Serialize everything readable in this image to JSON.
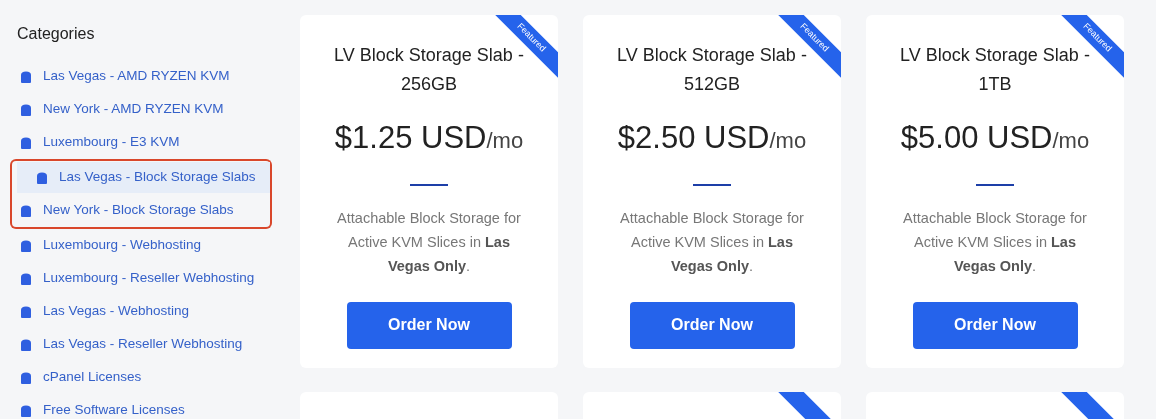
{
  "sidebar": {
    "title": "Categories",
    "items": [
      {
        "label": "Las Vegas - AMD RYZEN KVM",
        "selected": false,
        "highlighted": false
      },
      {
        "label": "New York - AMD RYZEN KVM",
        "selected": false,
        "highlighted": false
      },
      {
        "label": "Luxembourg - E3 KVM",
        "selected": false,
        "highlighted": false
      },
      {
        "label": "Las Vegas - Block Storage Slabs",
        "selected": true,
        "highlighted": true
      },
      {
        "label": "New York - Block Storage Slabs",
        "selected": false,
        "highlighted": true
      },
      {
        "label": "Luxembourg - Webhosting",
        "selected": false,
        "highlighted": false
      },
      {
        "label": "Luxembourg - Reseller Webhosting",
        "selected": false,
        "highlighted": false
      },
      {
        "label": "Las Vegas - Webhosting",
        "selected": false,
        "highlighted": false
      },
      {
        "label": "Las Vegas - Reseller Webhosting",
        "selected": false,
        "highlighted": false
      },
      {
        "label": "cPanel Licenses",
        "selected": false,
        "highlighted": false
      },
      {
        "label": "Free Software Licenses",
        "selected": false,
        "highlighted": false
      }
    ]
  },
  "products": [
    {
      "ribbon": "Featured",
      "name": "LV Block Storage Slab - 256GB",
      "price": "$1.25 USD",
      "period": "/mo",
      "description": "Attachable Block Storage for Active KVM Slices in **Las Vegas Only**.",
      "button": "Order Now"
    },
    {
      "ribbon": "Featured",
      "name": "LV Block Storage Slab - 512GB",
      "price": "$2.50 USD",
      "period": "/mo",
      "description": "Attachable Block Storage for Active KVM Slices in **Las Vegas Only**.",
      "button": "Order Now"
    },
    {
      "ribbon": "Featured",
      "name": "LV Block Storage Slab - 1TB",
      "price": "$5.00 USD",
      "period": "/mo",
      "description": "Attachable Block Storage for Active KVM Slices in **Las Vegas Only**.",
      "button": "Order Now"
    }
  ],
  "next_row": [
    {
      "featured": false
    },
    {
      "featured": true
    },
    {
      "featured": true
    }
  ]
}
